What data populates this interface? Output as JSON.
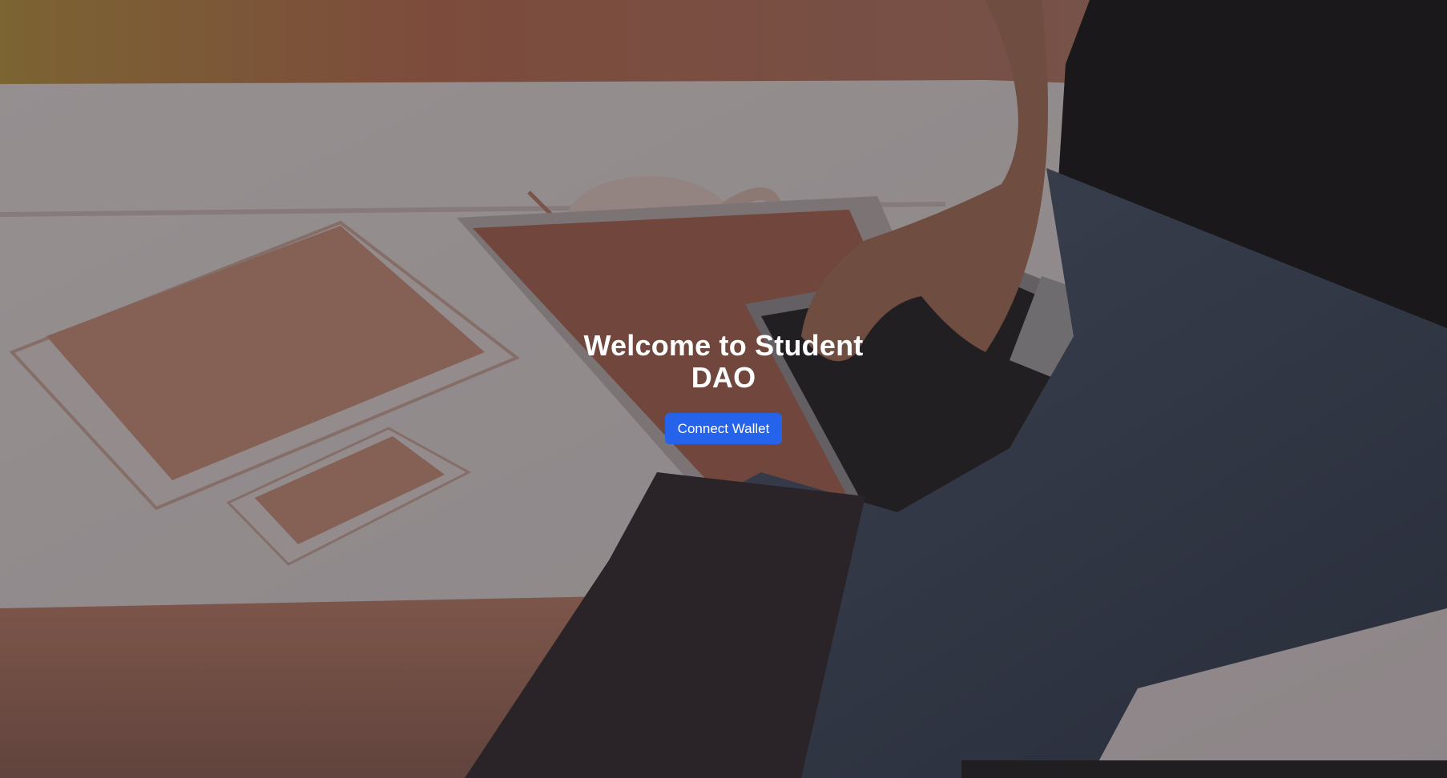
{
  "hero": {
    "title": "Welcome to Student DAO",
    "button_label": "Connect Wallet",
    "background_image": "person-typing-on-laptop-with-tablet-phone-and-coffee-cup",
    "overlay_color": "#140e12",
    "button_color": "#2563eb",
    "title_color": "#ffffff"
  }
}
